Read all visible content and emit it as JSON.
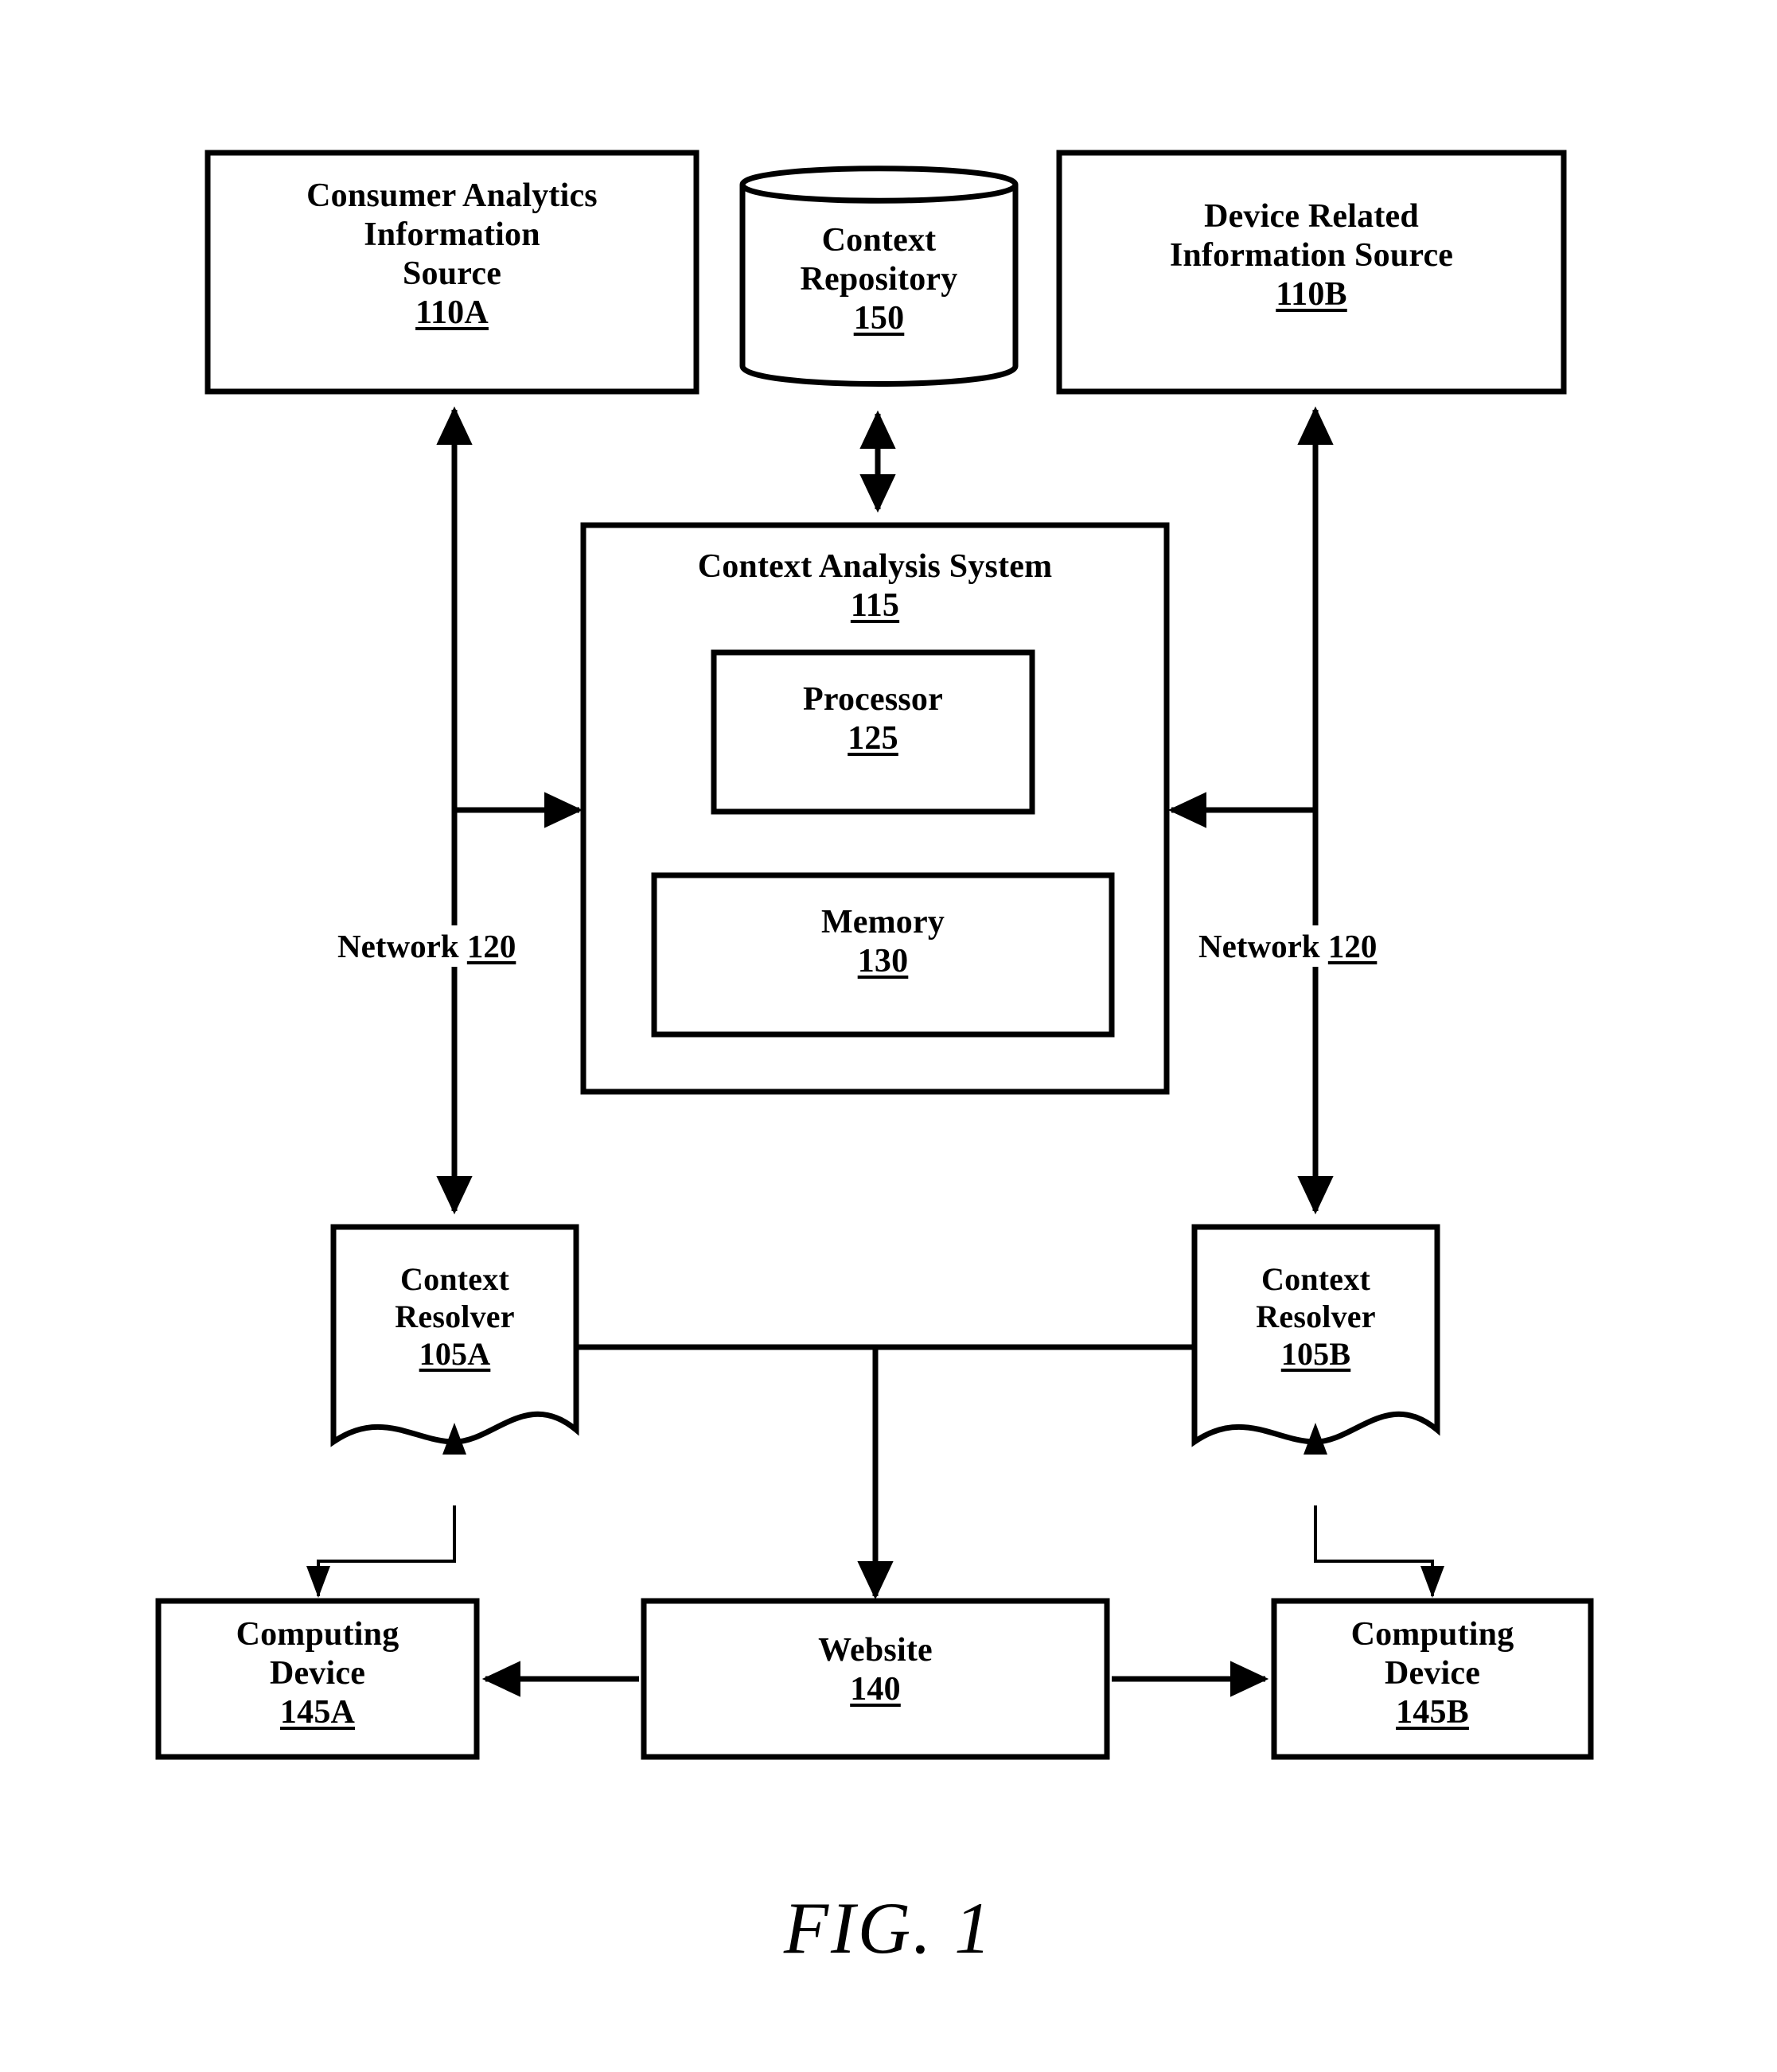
{
  "figure": {
    "caption": "FIG. 1",
    "title": "Context Analysis System block diagram"
  },
  "nodes": {
    "consumer_analytics": {
      "line1": "Consumer Analytics",
      "line2": "Information",
      "line3": "Source",
      "ref": "110A",
      "shape": "rectangle"
    },
    "context_repository": {
      "line1": "Context",
      "line2": "Repository",
      "ref": "150",
      "shape": "cylinder"
    },
    "device_related": {
      "line1": "Device Related",
      "line2": "Information Source",
      "ref": "110B",
      "shape": "rectangle"
    },
    "context_analysis_system": {
      "line1": "Context Analysis System",
      "ref": "115",
      "shape": "rectangle"
    },
    "processor": {
      "line1": "Processor",
      "ref": "125",
      "shape": "rectangle"
    },
    "memory": {
      "line1": "Memory",
      "ref": "130",
      "shape": "rectangle"
    },
    "context_resolver_a": {
      "line1": "Context",
      "line2": "Resolver",
      "ref": "105A",
      "shape": "document"
    },
    "context_resolver_b": {
      "line1": "Context",
      "line2": "Resolver",
      "ref": "105B",
      "shape": "document"
    },
    "computing_device_a": {
      "line1": "Computing",
      "line2": "Device",
      "ref": "145A",
      "shape": "rectangle"
    },
    "website": {
      "line1": "Website",
      "ref": "140",
      "shape": "rectangle"
    },
    "computing_device_b": {
      "line1": "Computing",
      "line2": "Device",
      "ref": "145B",
      "shape": "rectangle"
    }
  },
  "edge_labels": {
    "network_left": {
      "text": "Network ",
      "ref": "120"
    },
    "network_right": {
      "text": "Network ",
      "ref": "120"
    }
  },
  "colors": {
    "stroke": "#000000",
    "fill": "#ffffff",
    "text": "#000000",
    "background": "#ffffff"
  }
}
